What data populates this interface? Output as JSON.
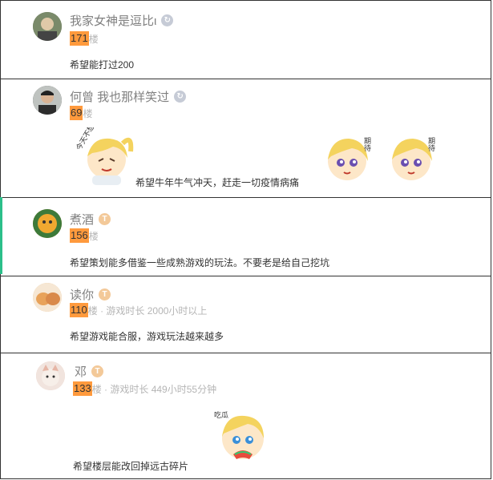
{
  "posts": [
    {
      "username": "我家女神是逗比ι",
      "floor": "171",
      "floor_suffix": "楼",
      "play_time": "",
      "content": "希望能打过200",
      "badge": "gray",
      "avatar_color": "#5a6a4a"
    },
    {
      "username": "何曾 我也那样笑过",
      "floor": "69",
      "floor_suffix": "楼",
      "play_time": "",
      "content": "希望牛年牛气冲天，赶走一切疫情病痛",
      "badge": "gray",
      "avatar_color": "#3d3d3d"
    },
    {
      "username": "煮酒",
      "floor": "156",
      "floor_suffix": "楼",
      "play_time": "",
      "content": "希望策划能多借鉴一些成熟游戏的玩法。不要老是给自己挖坑",
      "badge": "gold",
      "avatar_color": "#c8862a"
    },
    {
      "username": "读你",
      "floor": "110",
      "floor_suffix": "楼 · 游戏时长 2000小时以上",
      "play_time": "",
      "content": "希望游戏能合服，游戏玩法越来越多",
      "badge": "gold",
      "avatar_color": "#e8b77a"
    },
    {
      "username": "邓",
      "floor": "133",
      "floor_suffix": "楼 · 游戏时长 449小时55分钟",
      "play_time": "",
      "content": "希望楼层能改回掉远古碎片",
      "badge": "gold",
      "avatar_color": "#e9c7b8"
    }
  ],
  "sticker_captions": {
    "sticker_1": "今天不想",
    "sticker_2": "期待",
    "sticker_3": "期待",
    "sticker_4": "吃瓜"
  },
  "colors": {
    "floor_highlight": "#ff9a3d",
    "meta_gray": "#b5b5b5",
    "name_gray": "#808080",
    "accent_green": "#2bbf8a"
  }
}
